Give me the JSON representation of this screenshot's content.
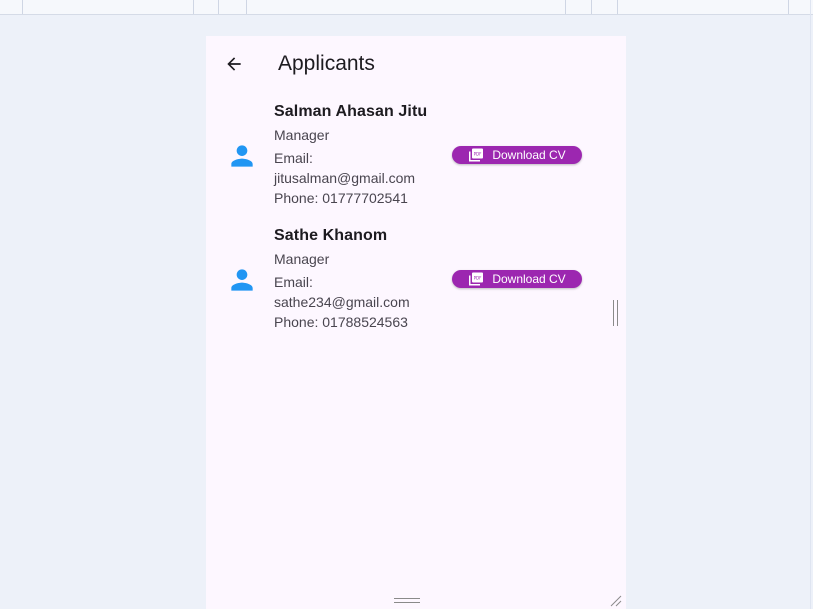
{
  "app_bar": {
    "title": "Applicants",
    "back_icon": "arrow-back-icon"
  },
  "applicants": [
    {
      "name": "Salman Ahasan Jitu",
      "role": "Manager",
      "email_label": "Email:",
      "email": "jitusalman@gmail.com",
      "phone": "Phone: 01777702541",
      "button_label": "Download CV",
      "button_icon": "pdf-icon",
      "avatar_icon": "person-icon"
    },
    {
      "name": "Sathe Khanom",
      "role": "Manager",
      "email_label": "Email:",
      "email": "sathe234@gmail.com",
      "phone": "Phone: 01788524563",
      "button_label": "Download CV",
      "button_icon": "pdf-icon",
      "avatar_icon": "person-icon"
    }
  ],
  "colors": {
    "page_background": "#edf1f9",
    "surface": "#fdf7ff",
    "avatar": "#2196f3",
    "button": "#9c27b0",
    "text_primary": "#1d1b20",
    "text_secondary": "#49454f"
  }
}
